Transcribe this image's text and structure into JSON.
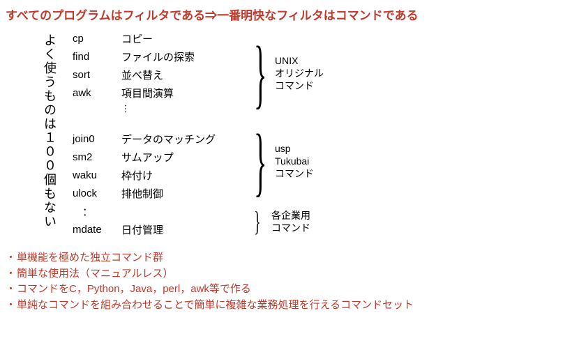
{
  "title": "すべてのプログラムはフィルタである⇒一番明快なフィルタはコマンドである",
  "vertical_label": "よく使うものは１００個もない",
  "group1": {
    "label_lines": [
      "UNIX",
      "オリジナル",
      "コマンド"
    ],
    "commands": [
      {
        "name": "cp",
        "desc": "コピー"
      },
      {
        "name": "find",
        "desc": "ファイルの探索"
      },
      {
        "name": "sort",
        "desc": "並べ替え"
      },
      {
        "name": "awk",
        "desc": "項目間演算"
      }
    ]
  },
  "group2": {
    "label_lines": [
      "usp",
      "Tukubai",
      "コマンド"
    ],
    "commands": [
      {
        "name": "join0",
        "desc": "データのマッチング"
      },
      {
        "name": "sm2",
        "desc": "サムアップ"
      },
      {
        "name": "waku",
        "desc": "枠付け"
      },
      {
        "name": "ulock",
        "desc": "排他制御"
      }
    ]
  },
  "group3": {
    "label_lines": [
      "各企業用",
      "コマンド"
    ],
    "commands": [
      {
        "name": "mdate",
        "desc": "日付管理"
      }
    ]
  },
  "vdots": "…",
  "colon": "：",
  "bullets": [
    "単機能を極めた独立コマンド群",
    "簡単な使用法（マニュアルレス）",
    "コマンドをC，Python，Java，perl，awk等で作る",
    "単純なコマンドを組み合わせることで簡単に複雑な業務処理を行えるコマンドセット"
  ],
  "bullet_mark": "・"
}
